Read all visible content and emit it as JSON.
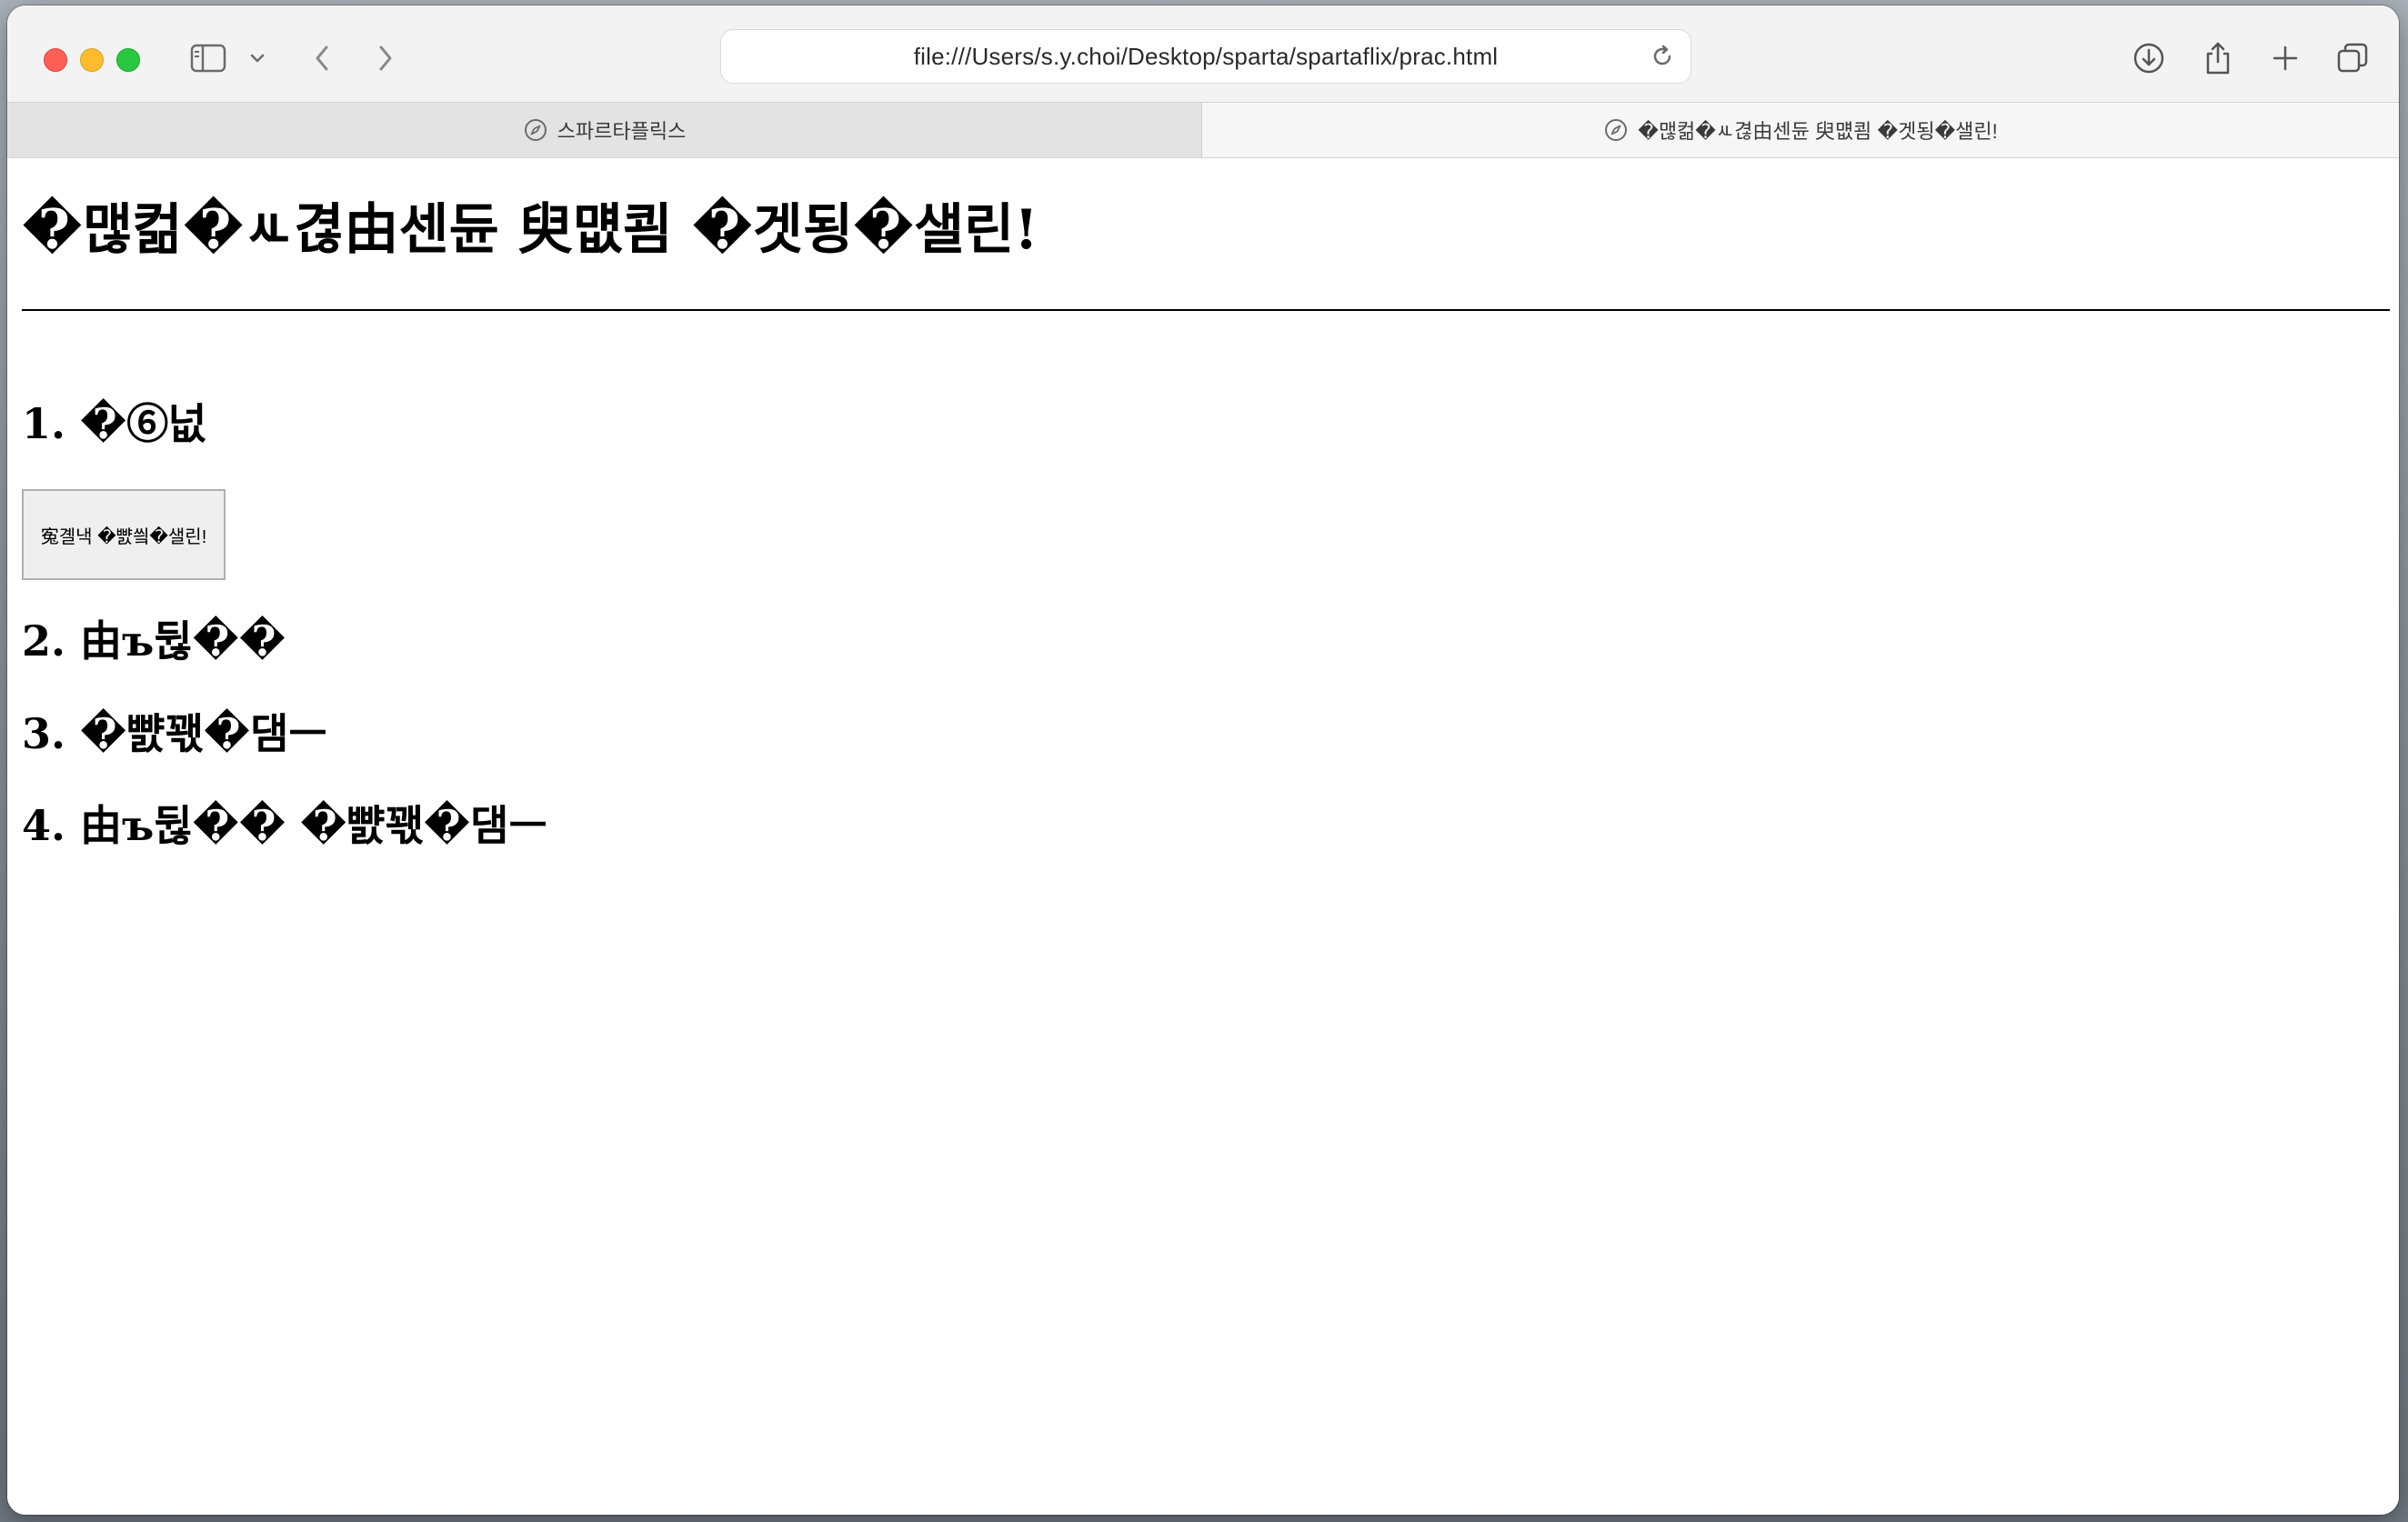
{
  "browser": {
    "url": "file:///Users/s.y.choi/Desktop/sparta/spartaflix/prac.html",
    "tabs": [
      {
        "title": "스파르타플릭스",
        "active": false
      },
      {
        "title": "�맪컮�ㅻ겮由센듄 臾먮쾸 �겟됭�샐린!",
        "active": true
      }
    ]
  },
  "page": {
    "heading": "�맪컮�ㅻ겮由센듄 臾먮쾸 �겟됭�샐린!",
    "sections": [
      {
        "title": "1. �⑥넚"
      },
      {
        "title": "2. 由ъ뒪��"
      },
      {
        "title": "3. �뺤꽧�댐ㅡ"
      },
      {
        "title": "4. 由ъ뒪�� �뺤꽧�댐ㅡ"
      }
    ],
    "button_label": "寃곌낵 �뺤씤�샐린!"
  },
  "colors": {
    "close": "#ff5f57",
    "minimize": "#febc2e",
    "maximize": "#28c840"
  }
}
